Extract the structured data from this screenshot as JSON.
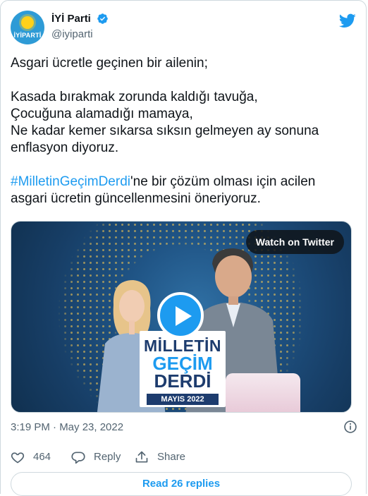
{
  "author": {
    "display_name": "İYİ Parti",
    "handle": "@iyiparti",
    "avatar_text": "İYİPARTİ"
  },
  "tweet": {
    "line1": "Asgari ücretle geçinen bir ailenin;",
    "line2": "Kasada bırakmak zorunda kaldığı tavuğa,",
    "line3": "Çocuğuna alamadığı mamaya,",
    "line4": "Ne kadar kemer sıkarsa sıksın gelmeyen ay sonuna",
    "line5": "enflasyon diyoruz.",
    "hashtag": "#MilletinGeçimDerdi",
    "line6_rest": "'ne bir çözüm olması için acilen",
    "line7": "asgari ücretin güncellenmesini öneriyoruz."
  },
  "media": {
    "watch_label": "Watch on Twitter",
    "campaign_line1": "MİLLETİN",
    "campaign_line2": "GEÇİM",
    "campaign_line3": "DERDİ",
    "campaign_line4": "MAYIS 2022"
  },
  "meta": {
    "timestamp": "3:19 PM · May 23, 2022"
  },
  "actions": {
    "like_count": "464",
    "reply_label": "Reply",
    "share_label": "Share"
  },
  "read_replies_label": "Read 26 replies",
  "colors": {
    "accent": "#1d9bf0",
    "text": "#0f1419",
    "muted": "#536471",
    "border": "#cfd9de"
  }
}
